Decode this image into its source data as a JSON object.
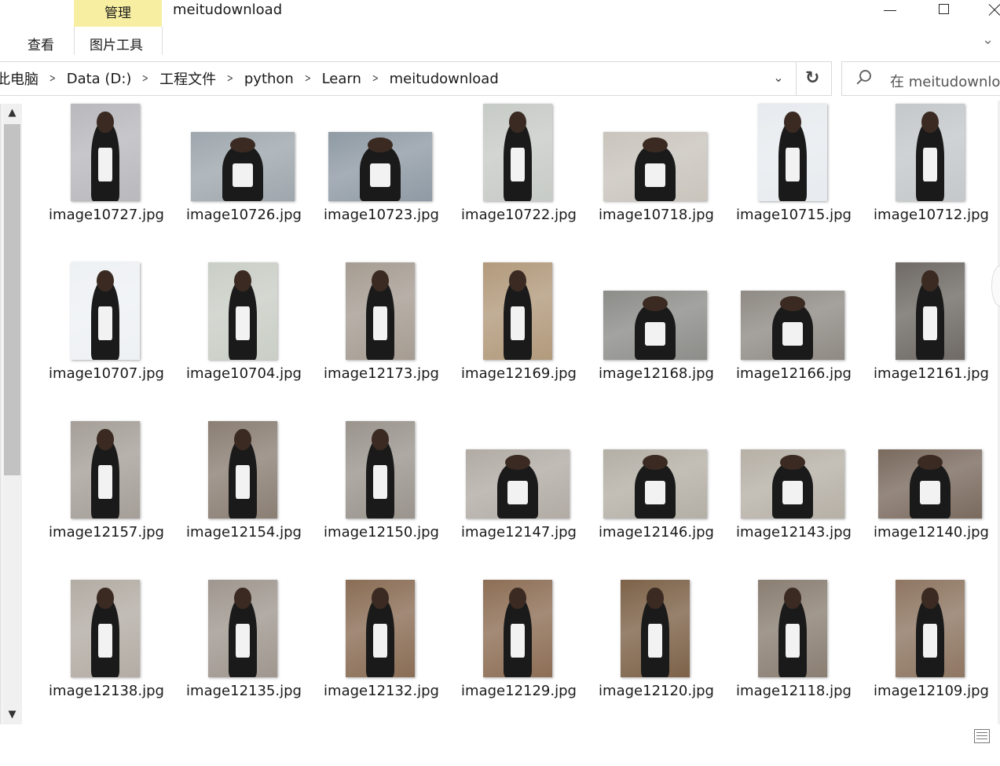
{
  "window": {
    "title": "meitudownload",
    "contextual_tab": "管理",
    "ribbon_tabs": [
      "查看",
      "图片工具"
    ]
  },
  "address": {
    "crumbs": [
      "此电脑",
      "Data (D:)",
      "工程文件",
      "python",
      "Learn",
      "meitudownload"
    ]
  },
  "search": {
    "placeholder": "在 meitudownload 中搜索"
  },
  "files": [
    {
      "name": "image10727.jpg",
      "orientation": "portrait",
      "tone": "#b9b9bd"
    },
    {
      "name": "image10726.jpg",
      "orientation": "landscape",
      "tone": "#9ea7ad"
    },
    {
      "name": "image10723.jpg",
      "orientation": "landscape",
      "tone": "#8f9aa4"
    },
    {
      "name": "image10722.jpg",
      "orientation": "portrait",
      "tone": "#c7cbc6"
    },
    {
      "name": "image10718.jpg",
      "orientation": "landscape",
      "tone": "#c9c4bc"
    },
    {
      "name": "image10715.jpg",
      "orientation": "portrait",
      "tone": "#e7ebef"
    },
    {
      "name": "image10712.jpg",
      "orientation": "portrait",
      "tone": "#c4c8cb"
    },
    {
      "name": "image10707.jpg",
      "orientation": "portrait",
      "tone": "#eef1f4"
    },
    {
      "name": "image10704.jpg",
      "orientation": "portrait",
      "tone": "#c9cec6"
    },
    {
      "name": "image12173.jpg",
      "orientation": "portrait",
      "tone": "#a69c92"
    },
    {
      "name": "image12169.jpg",
      "orientation": "portrait",
      "tone": "#b29a7c"
    },
    {
      "name": "image12168.jpg",
      "orientation": "landscape",
      "tone": "#8c8d89"
    },
    {
      "name": "image12166.jpg",
      "orientation": "landscape",
      "tone": "#8f8a84"
    },
    {
      "name": "image12161.jpg",
      "orientation": "portrait",
      "tone": "#6f6a65"
    },
    {
      "name": "image12157.jpg",
      "orientation": "portrait",
      "tone": "#a59f98"
    },
    {
      "name": "image12154.jpg",
      "orientation": "portrait",
      "tone": "#8b7f74"
    },
    {
      "name": "image12150.jpg",
      "orientation": "portrait",
      "tone": "#9a948d"
    },
    {
      "name": "image12147.jpg",
      "orientation": "landscape",
      "tone": "#b1aba4"
    },
    {
      "name": "image12146.jpg",
      "orientation": "landscape",
      "tone": "#b4afa5"
    },
    {
      "name": "image12143.jpg",
      "orientation": "landscape",
      "tone": "#b6b0a6"
    },
    {
      "name": "image12140.jpg",
      "orientation": "landscape",
      "tone": "#7a6a5e"
    },
    {
      "name": "image12138.jpg",
      "orientation": "portrait",
      "tone": "#b3aca4"
    },
    {
      "name": "image12135.jpg",
      "orientation": "portrait",
      "tone": "#9f978f"
    },
    {
      "name": "image12132.jpg",
      "orientation": "portrait",
      "tone": "#8a6d55"
    },
    {
      "name": "image12129.jpg",
      "orientation": "portrait",
      "tone": "#8d6e55"
    },
    {
      "name": "image12120.jpg",
      "orientation": "portrait",
      "tone": "#7d6248"
    },
    {
      "name": "image12118.jpg",
      "orientation": "portrait",
      "tone": "#8a7e72"
    },
    {
      "name": "image12109.jpg",
      "orientation": "portrait",
      "tone": "#8e7662"
    }
  ]
}
